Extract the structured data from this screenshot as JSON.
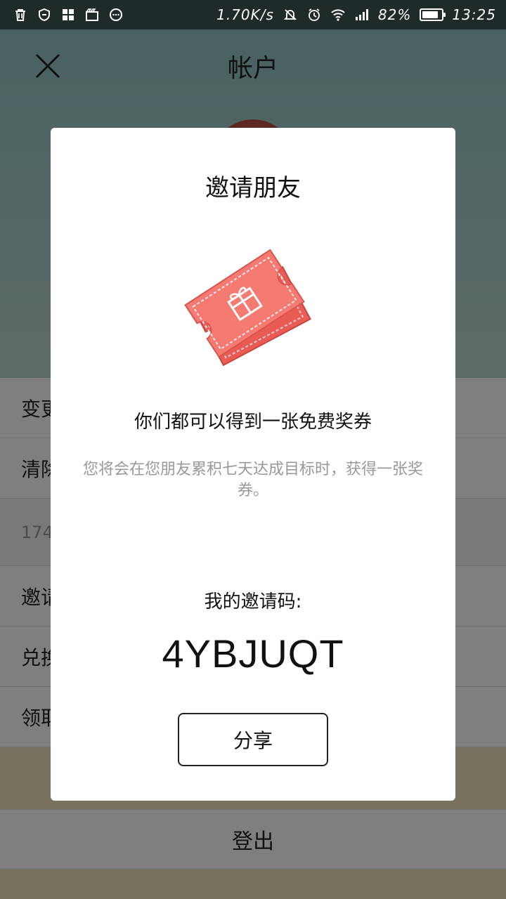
{
  "status_bar": {
    "network_speed": "1.70K/s",
    "battery_percent": "82%",
    "battery_level": 0.82,
    "time": "13:25",
    "left_icons": [
      "trash-icon",
      "shield-icon",
      "apps-icon",
      "clapper-icon",
      "chat-bubble-icon"
    ],
    "right_icons": [
      "mute-icon",
      "alarm-icon",
      "wifi-icon",
      "signal-icon",
      "battery-icon"
    ]
  },
  "header": {
    "title": "帐户",
    "close_icon": "close-icon"
  },
  "menu": {
    "items": [
      {
        "label": "变更"
      },
      {
        "label": "清除"
      }
    ],
    "phone": "174",
    "items2": [
      {
        "label": "邀请"
      },
      {
        "label": "兑换"
      },
      {
        "label": "领取"
      }
    ],
    "logout_label": "登出"
  },
  "dialog": {
    "title": "邀请朋友",
    "headline": "你们都可以得到一张免费奖券",
    "description": "您将会在您朋友累积七天达成目标时，获得一张奖券。",
    "code_label": "我的邀请码:",
    "invite_code": "4YBJUQT",
    "share_label": "分享",
    "ticket_color": "#f07167"
  }
}
